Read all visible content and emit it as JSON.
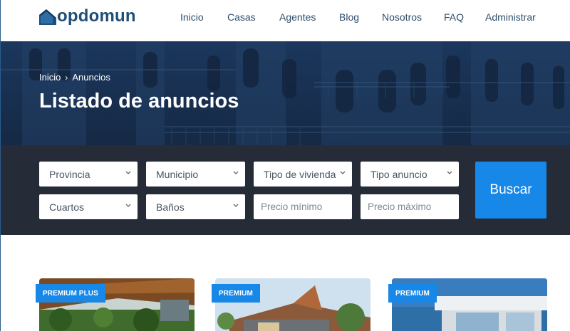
{
  "brand": {
    "name": "opdomun",
    "logo_icon": "house-roof-icon",
    "color": "#1f4e79"
  },
  "nav": {
    "items": [
      {
        "label": "Inicio"
      },
      {
        "label": "Casas"
      },
      {
        "label": "Agentes"
      },
      {
        "label": "Blog"
      },
      {
        "label": "Nosotros"
      },
      {
        "label": "FAQ"
      },
      {
        "label": "Administrar"
      }
    ]
  },
  "hero": {
    "breadcrumb": {
      "home": "Inicio",
      "separator": "›",
      "current": "Anuncios"
    },
    "title": "Listado de anuncios"
  },
  "search": {
    "selects": [
      {
        "label": "Provincia"
      },
      {
        "label": "Municipio"
      },
      {
        "label": "Tipo de vivienda"
      },
      {
        "label": "Tipo anuncio"
      },
      {
        "label": "Cuartos"
      },
      {
        "label": "Baños"
      }
    ],
    "price_min_placeholder": "Precio mínimo",
    "price_max_placeholder": "Precio máximo",
    "button_label": "Buscar",
    "accent_color": "#1787e8"
  },
  "listings": [
    {
      "badge": "PREMIUM PLUS"
    },
    {
      "badge": "PREMIUM"
    },
    {
      "badge": "PREMIUM"
    }
  ]
}
